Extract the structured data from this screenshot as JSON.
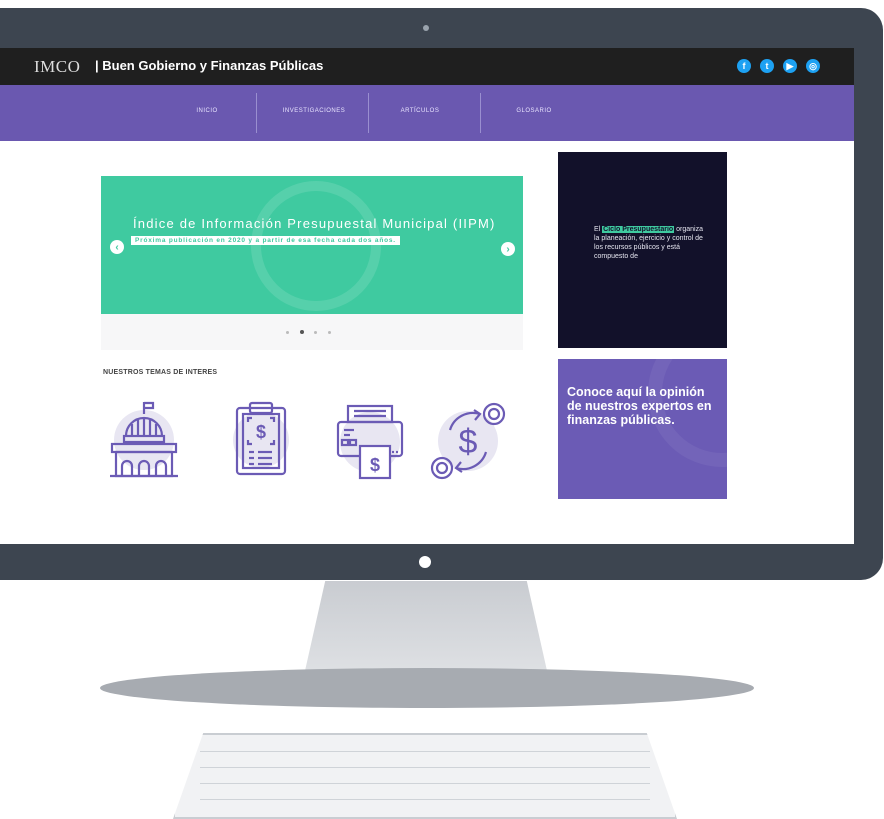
{
  "site": {
    "logo": "IMCO",
    "title": "| Buen Gobierno y Finanzas Públicas",
    "social": [
      {
        "icon": "facebook-icon",
        "glyph": "f",
        "color": "#1da1f2"
      },
      {
        "icon": "twitter-icon",
        "glyph": "t",
        "color": "#1da1f2"
      },
      {
        "icon": "youtube-icon",
        "glyph": "▶",
        "color": "#1da1f2"
      },
      {
        "icon": "instagram-icon",
        "glyph": "◎",
        "color": "#1da1f2"
      }
    ]
  },
  "nav": {
    "items": [
      "INICIO",
      "INVESTIGACIONES",
      "ARTÍCULOS",
      "GLOSARIO"
    ]
  },
  "slider": {
    "title": "Índice de Información Presupuestal Municipal (IIPM)",
    "subtitle": "Próxima publicación en 2020 y a partir de esa fecha cada dos años.",
    "prev_icon": "chevron-left-icon",
    "next_icon": "chevron-right-icon",
    "dot_count": 4,
    "active_dot": 1
  },
  "temas": {
    "heading": "NUESTROS TEMAS DE INTERES",
    "icons": [
      "government-building-icon",
      "clipboard-budget-icon",
      "printer-money-icon",
      "currency-exchange-icon"
    ]
  },
  "side_dark": {
    "text_pre": "El ",
    "highlight": "Ciclo Presupuestario",
    "text_post": " organiza la planeación, ejercicio y control de los recursos públicos y está compuesto de"
  },
  "side_purple": {
    "text": "Conoce aquí la opinión de nuestros expertos en finanzas públicas."
  },
  "colors": {
    "topbar": "#1f1f1f",
    "nav": "#6a58b0",
    "slider": "#3fcaa0",
    "dark_panel": "#12112a",
    "purple_panel": "#6b5bb5",
    "icon_stroke": "#6b5bb5"
  }
}
